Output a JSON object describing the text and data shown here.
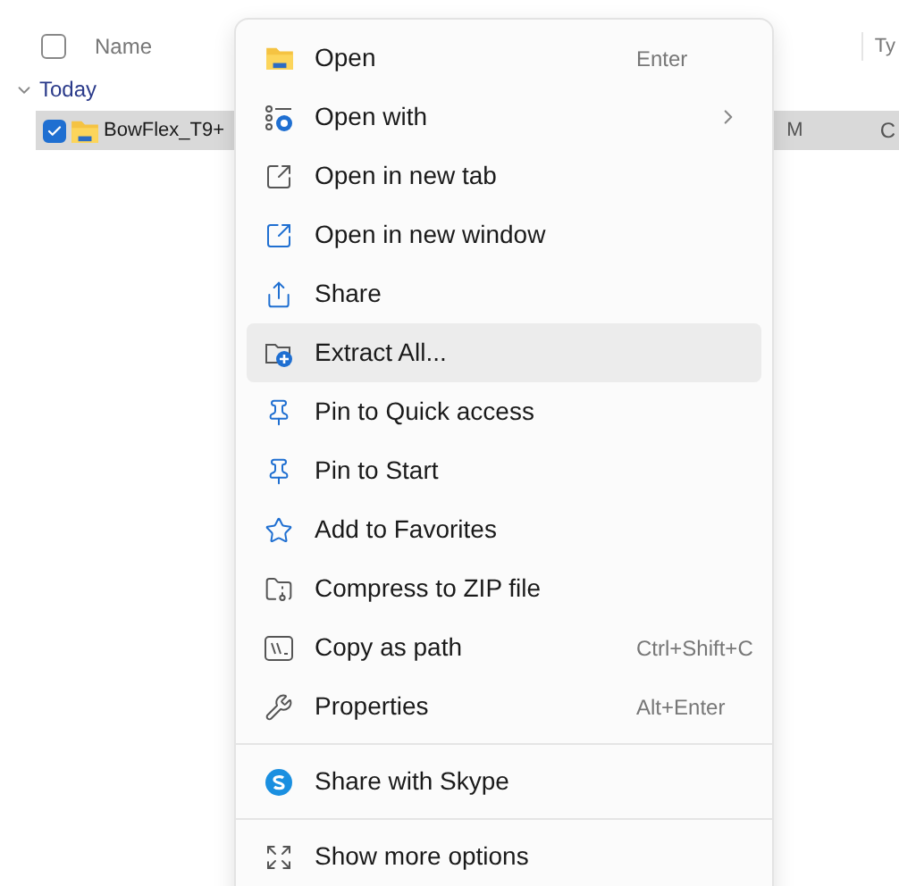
{
  "file_list": {
    "columns": [
      {
        "label": "Name"
      },
      {
        "label": "Ty"
      }
    ],
    "select_all": {
      "checked": false
    },
    "groups": [
      {
        "label": "Today",
        "expanded": true,
        "rows": [
          {
            "name": "BowFlex_T9+",
            "selected": true,
            "checked": true,
            "cells": [
              "M",
              "C"
            ]
          }
        ]
      }
    ]
  },
  "context_menu": {
    "sections": [
      [
        {
          "label": "Open",
          "shortcut": "Enter",
          "submenu": false,
          "selected": false
        },
        {
          "label": "Open with",
          "submenu": true,
          "selected": false
        },
        {
          "label": "Open in new tab",
          "submenu": false,
          "selected": false
        },
        {
          "label": "Open in new window",
          "submenu": false,
          "selected": false
        },
        {
          "label": "Share",
          "submenu": false,
          "selected": false
        },
        {
          "label": "Extract All...",
          "submenu": false,
          "selected": true
        },
        {
          "label": "Pin to Quick access",
          "submenu": false,
          "selected": false
        },
        {
          "label": "Pin to Start",
          "submenu": false,
          "selected": false
        },
        {
          "label": "Add to Favorites",
          "submenu": false,
          "selected": false
        },
        {
          "label": "Compress to ZIP file",
          "submenu": false,
          "selected": false
        },
        {
          "label": "Copy as path",
          "shortcut": "Ctrl+Shift+C",
          "submenu": false,
          "selected": false
        },
        {
          "label": "Properties",
          "shortcut": "Alt+Enter",
          "submenu": false,
          "selected": false
        }
      ],
      [
        {
          "label": "Share with Skype",
          "submenu": false,
          "selected": false
        }
      ],
      [
        {
          "label": "Show more options",
          "submenu": false,
          "selected": false
        }
      ]
    ]
  }
}
